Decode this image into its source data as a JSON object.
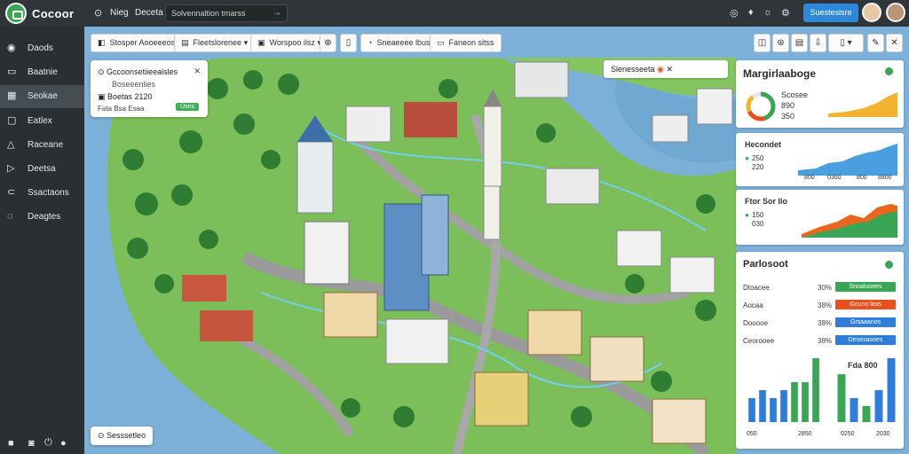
{
  "app": {
    "brand": "Cocoor"
  },
  "topbar": {
    "links": [
      "Nieg",
      "Deceta"
    ],
    "search_text": "Solvennaltion tmarss",
    "submit_label": "Suestesisre"
  },
  "sidebar": {
    "items": [
      {
        "label": "Daods",
        "icon": "home-icon"
      },
      {
        "label": "Baatnie",
        "icon": "folder-icon"
      },
      {
        "label": "Seokae",
        "icon": "grid-icon"
      },
      {
        "label": "Eatlex",
        "icon": "square-icon"
      },
      {
        "label": "Raceane",
        "icon": "bell-icon"
      },
      {
        "label": "Deetsa",
        "icon": "play-icon"
      },
      {
        "label": "Ssactaons",
        "icon": "share-icon"
      },
      {
        "label": "Deagtes",
        "icon": "help-icon"
      }
    ]
  },
  "toolbar": {
    "chips": [
      "Stosper Aooeeeos",
      "Fleetslorenee",
      "Worspoo ilsz",
      "",
      "",
      "Sneaeeee lbus",
      "Faneon sitss"
    ]
  },
  "info_card": {
    "title": "Gccoonsetiieealsles",
    "subtitle": "Boseeenlies",
    "line": "Boetas 2120",
    "meta": "Fata   Bsa   Esaa",
    "tag": "Uses"
  },
  "map_pill": "Slenesseeta",
  "bottom_pill": "Sesssetleo",
  "right_panel": {
    "title": "Margirlaaboge",
    "gauge_label": "Scosee",
    "gauge_value": "890",
    "gauge_value2": "350",
    "chart1_title": "Hecondet",
    "chart1_values": [
      "250",
      "220"
    ],
    "chart1_ticks": [
      "800",
      "0360",
      "800",
      "8800"
    ],
    "chart2_title": "Ftor Sor Ilo",
    "chart2_values": [
      "150",
      "030"
    ],
    "breakdown_title": "Parlosoot",
    "rows": [
      {
        "label": "Dtoacee",
        "pct": "30%",
        "bar_label": "Snoaluoees",
        "color": "#3aa655"
      },
      {
        "label": "Aocaa",
        "pct": "38%",
        "bar_label": "Gouno lass",
        "color": "#e8501f"
      },
      {
        "label": "Dooooe",
        "pct": "38%",
        "bar_label": "Grsaaanos",
        "color": "#2f7dd8"
      },
      {
        "label": "Ceorooee",
        "pct": "38%",
        "bar_label": "Desesaoses",
        "color": "#2f7dd8"
      }
    ],
    "bar_chart_left": {
      "values": [
        3,
        4,
        3,
        4,
        5,
        5,
        8
      ],
      "axis": [
        "050",
        "2850"
      ],
      "colors": [
        "#2f7dd8",
        "#2f7dd8",
        "#2f7dd8",
        "#2f7dd8",
        "#3aa655",
        "#3aa655",
        "#3aa655"
      ]
    },
    "bar_chart_right": {
      "title": "Fda 800",
      "values": [
        6,
        3,
        2,
        4,
        8
      ],
      "axis": [
        "0250",
        "2030"
      ],
      "colors": [
        "#3aa655",
        "#2f7dd8",
        "#3aa655",
        "#2f7dd8",
        "#2f7dd8"
      ]
    }
  }
}
